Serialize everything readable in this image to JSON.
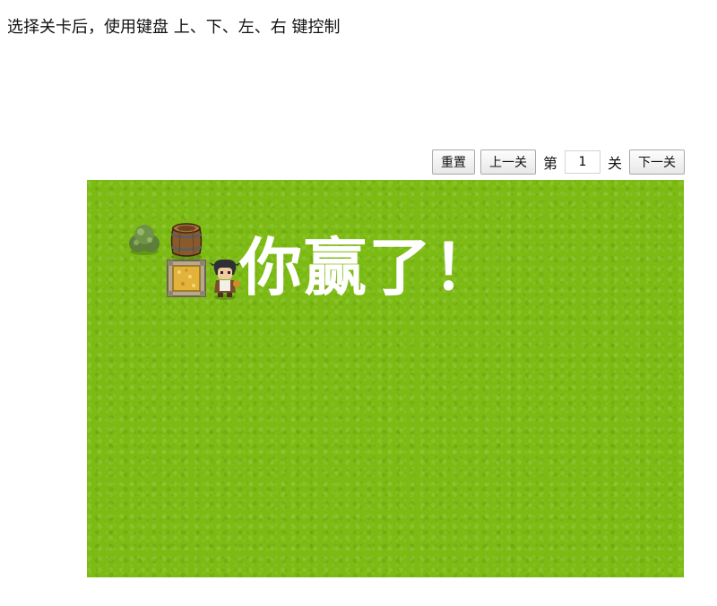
{
  "instructions": "选择关卡后，使用键盘 上、下、左、右 键控制",
  "controls": {
    "reset_label": "重置",
    "prev_label": "上一关",
    "level_prefix": "第",
    "level_value": "1",
    "level_suffix": "关",
    "next_label": "下一关"
  },
  "board": {
    "background_color": "#7cbb13",
    "win_message": "你赢了！",
    "tiles": [
      {
        "type": "bush",
        "icon": "bush-icon"
      },
      {
        "type": "barrel",
        "icon": "barrel-icon"
      },
      {
        "type": "target",
        "icon": "target-icon"
      },
      {
        "type": "player",
        "icon": "player-icon"
      }
    ]
  }
}
